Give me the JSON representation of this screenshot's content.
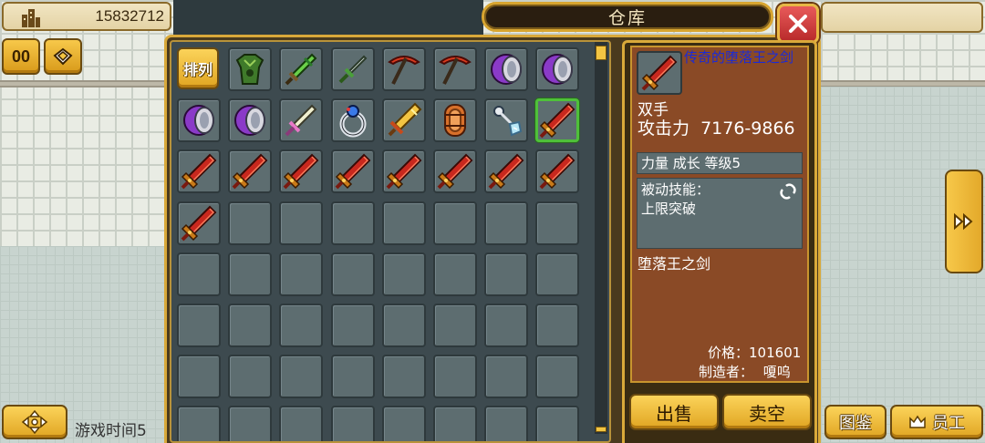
{
  "hud": {
    "money": "15832712",
    "game_time_label": "游戏时间5",
    "pause_label": "00"
  },
  "warehouse": {
    "title": "仓库",
    "sort_label": "排列",
    "slots": [
      {
        "icon": "sort-button"
      },
      {
        "icon": "green-armor"
      },
      {
        "icon": "green-sword"
      },
      {
        "icon": "green-dagger"
      },
      {
        "icon": "red-pickaxe"
      },
      {
        "icon": "red-pickaxe"
      },
      {
        "icon": "purple-drum"
      },
      {
        "icon": "purple-drum"
      },
      {
        "icon": "purple-drum"
      },
      {
        "icon": "purple-drum"
      },
      {
        "icon": "pink-sword"
      },
      {
        "icon": "silver-ring"
      },
      {
        "icon": "gold-sword"
      },
      {
        "icon": "wooden-shield"
      },
      {
        "icon": "ice-wand"
      },
      {
        "icon": "fallen-king-sword",
        "selected": true
      },
      {
        "icon": "fallen-king-sword"
      },
      {
        "icon": "fallen-king-sword"
      },
      {
        "icon": "fallen-king-sword"
      },
      {
        "icon": "fallen-king-sword"
      },
      {
        "icon": "fallen-king-sword"
      },
      {
        "icon": "fallen-king-sword"
      },
      {
        "icon": "fallen-king-sword"
      },
      {
        "icon": "fallen-king-sword"
      },
      {
        "icon": "fallen-king-sword"
      }
    ],
    "visible_rows": 8,
    "columns": 8
  },
  "detail": {
    "name": "传奇的堕落王之剑",
    "hand_type": "双手",
    "attack_label": "攻击力",
    "attack_value": "7176-9866",
    "stats": "力量 成长 等级5",
    "passive_title": "被动技能：",
    "passive_value": "上限突破",
    "description": "堕落王之剑",
    "price_label": "价格：",
    "price_value": "101601",
    "maker_label": "制造者：",
    "maker_value": "嗄呜",
    "sell_label": "出售",
    "clear_label": "卖空"
  },
  "bottom_nav": {
    "catalog_label": "图鉴",
    "staff_label": "员工"
  },
  "colors": {
    "gold": "#d9a93a",
    "selected": "#4fc03a",
    "item_name": "#1a2ad8",
    "close": "#c83030"
  }
}
